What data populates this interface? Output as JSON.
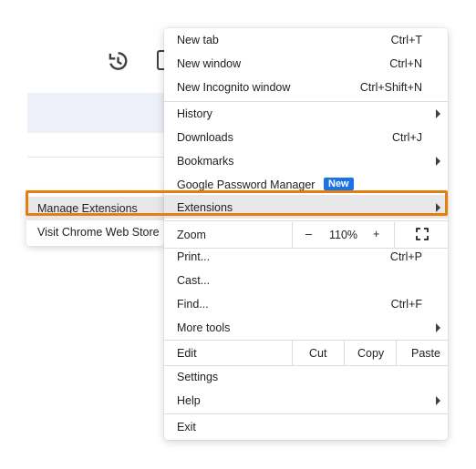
{
  "menu": {
    "items": [
      {
        "label": "New tab",
        "shortcut": "Ctrl+T"
      },
      {
        "label": "New window",
        "shortcut": "Ctrl+N"
      },
      {
        "label": "New Incognito window",
        "shortcut": "Ctrl+Shift+N"
      },
      {
        "label": "History",
        "has_submenu": true
      },
      {
        "label": "Downloads",
        "shortcut": "Ctrl+J"
      },
      {
        "label": "Bookmarks",
        "has_submenu": true
      },
      {
        "label": "Google Password Manager",
        "badge": "New"
      },
      {
        "label": "Extensions",
        "has_submenu": true,
        "highlighted": true
      },
      {
        "label": "Print...",
        "shortcut": "Ctrl+P"
      },
      {
        "label": "Cast..."
      },
      {
        "label": "Find...",
        "shortcut": "Ctrl+F"
      },
      {
        "label": "More tools",
        "has_submenu": true
      },
      {
        "label": "Settings"
      },
      {
        "label": "Help",
        "has_submenu": true
      },
      {
        "label": "Exit"
      }
    ],
    "zoom": {
      "label": "Zoom",
      "minus": "–",
      "value": "110%",
      "plus": "+"
    },
    "edit": {
      "label": "Edit",
      "cut": "Cut",
      "copy": "Copy",
      "paste": "Paste"
    }
  },
  "submenu": {
    "items": [
      {
        "label": "Manage Extensions"
      },
      {
        "label": "Visit Chrome Web Store"
      }
    ]
  },
  "colors": {
    "accent": "#1a73e8",
    "highlight_border": "#e37f0e",
    "hover": "#e8e8ea"
  },
  "icons": {
    "toolbar": "history-icon",
    "fullscreen": "fullscreen-icon"
  }
}
